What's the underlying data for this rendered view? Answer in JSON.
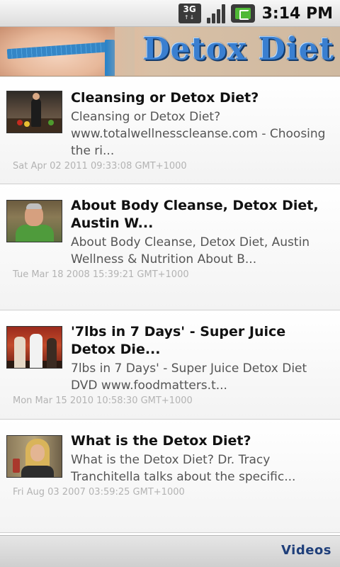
{
  "status_bar": {
    "network_label": "3G",
    "network_sub": "↑↓",
    "time": "3:14 PM"
  },
  "header": {
    "title": "Detox Diet"
  },
  "videos": [
    {
      "title": "Cleansing or Detox Diet?",
      "description": "Cleansing or Detox Diet? www.totalwellnesscleanse.com - Choosing the ri...",
      "date": "Sat Apr 02 2011 09:33:08 GMT+1000"
    },
    {
      "title": "About Body Cleanse, Detox Diet, Austin W...",
      "description": "About Body Cleanse, Detox Diet, Austin Wellness & Nutrition About B...",
      "date": "Tue Mar 18 2008 15:39:21 GMT+1000"
    },
    {
      "title": "'7lbs in 7 Days' - Super Juice Detox Die...",
      "description": "7lbs in 7 Days' - Super Juice Detox Diet DVD www.foodmatters.t...",
      "date": "Mon Mar 15 2010 10:58:30 GMT+1000"
    },
    {
      "title": "What is the Detox Diet?",
      "description": "What is the Detox Diet? Dr. Tracy Tranchitella talks about the specific...",
      "date": "Fri Aug 03 2007 03:59:25 GMT+1000"
    }
  ],
  "bottom_bar": {
    "videos_label": "Videos"
  },
  "colors": {
    "banner_title": "#3a7fd0",
    "bottom_link": "#1f3f7a",
    "date_text": "#b3b3b3",
    "battery_green": "#4fb836"
  }
}
